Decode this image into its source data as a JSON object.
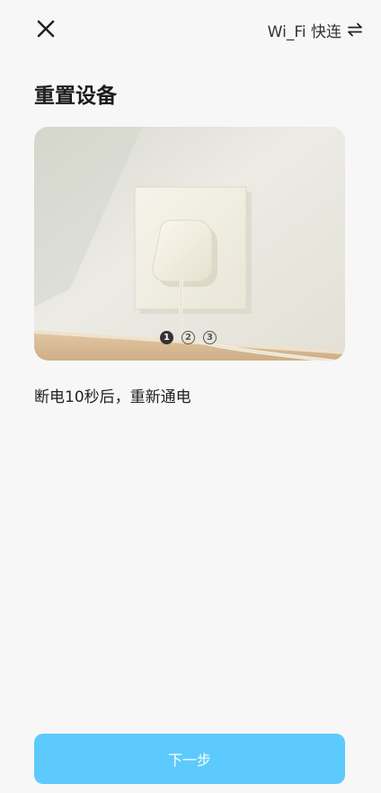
{
  "header": {
    "close_icon": "close-icon",
    "mode_switch_label": "Wi_Fi 快连",
    "mode_switch_icon": "swap-arrows-icon"
  },
  "page": {
    "title": "重置设备"
  },
  "illustration": {
    "description_icon": "wall-socket-plug-image",
    "steps": [
      {
        "label": "1",
        "active": true
      },
      {
        "label": "2",
        "active": false
      },
      {
        "label": "3",
        "active": false
      }
    ]
  },
  "instruction": {
    "text": "断电10秒后，重新通电"
  },
  "footer": {
    "next_label": "下一步"
  },
  "colors": {
    "background": "#f7f7f7",
    "primary_button": "#5ccafc",
    "text": "#222222"
  }
}
